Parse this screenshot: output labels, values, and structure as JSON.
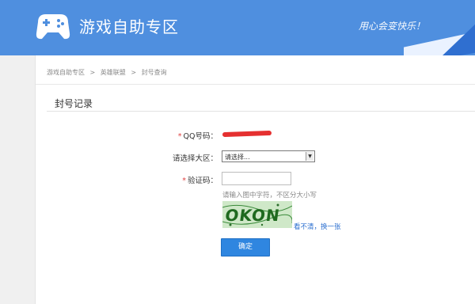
{
  "header": {
    "site_title": "游戏自助专区",
    "slogan": "用心会变快乐！"
  },
  "breadcrumb": {
    "items": [
      "游戏自助专区",
      "英雄联盟",
      "封号查询"
    ],
    "separator": ">"
  },
  "section": {
    "title": "封号记录"
  },
  "form": {
    "qq_label": "QQ号码：",
    "region_label": "请选择大区：",
    "region_value": "请选择...",
    "captcha_label": "验证码：",
    "captcha_value": "",
    "captcha_hint": "请输入图中字符，不区分大小写",
    "captcha_text": "OKON",
    "refresh_label": "看不清，换一张",
    "submit_label": "确定",
    "required_mark": "*"
  },
  "colors": {
    "header_bg": "#4f8fdf",
    "accent": "#2f86e0",
    "link": "#2b6fcf",
    "required": "#e04040"
  }
}
